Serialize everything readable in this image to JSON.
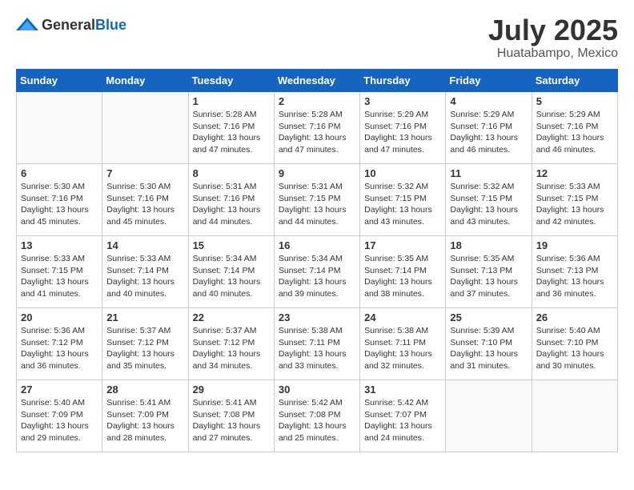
{
  "header": {
    "logo_general": "General",
    "logo_blue": "Blue",
    "month_title": "July 2025",
    "location": "Huatabampo, Mexico"
  },
  "weekdays": [
    "Sunday",
    "Monday",
    "Tuesday",
    "Wednesday",
    "Thursday",
    "Friday",
    "Saturday"
  ],
  "weeks": [
    [
      {
        "day": "",
        "info": ""
      },
      {
        "day": "",
        "info": ""
      },
      {
        "day": "1",
        "info": "Sunrise: 5:28 AM\nSunset: 7:16 PM\nDaylight: 13 hours and 47 minutes."
      },
      {
        "day": "2",
        "info": "Sunrise: 5:28 AM\nSunset: 7:16 PM\nDaylight: 13 hours and 47 minutes."
      },
      {
        "day": "3",
        "info": "Sunrise: 5:29 AM\nSunset: 7:16 PM\nDaylight: 13 hours and 47 minutes."
      },
      {
        "day": "4",
        "info": "Sunrise: 5:29 AM\nSunset: 7:16 PM\nDaylight: 13 hours and 46 minutes."
      },
      {
        "day": "5",
        "info": "Sunrise: 5:29 AM\nSunset: 7:16 PM\nDaylight: 13 hours and 46 minutes."
      }
    ],
    [
      {
        "day": "6",
        "info": "Sunrise: 5:30 AM\nSunset: 7:16 PM\nDaylight: 13 hours and 45 minutes."
      },
      {
        "day": "7",
        "info": "Sunrise: 5:30 AM\nSunset: 7:16 PM\nDaylight: 13 hours and 45 minutes."
      },
      {
        "day": "8",
        "info": "Sunrise: 5:31 AM\nSunset: 7:16 PM\nDaylight: 13 hours and 44 minutes."
      },
      {
        "day": "9",
        "info": "Sunrise: 5:31 AM\nSunset: 7:15 PM\nDaylight: 13 hours and 44 minutes."
      },
      {
        "day": "10",
        "info": "Sunrise: 5:32 AM\nSunset: 7:15 PM\nDaylight: 13 hours and 43 minutes."
      },
      {
        "day": "11",
        "info": "Sunrise: 5:32 AM\nSunset: 7:15 PM\nDaylight: 13 hours and 43 minutes."
      },
      {
        "day": "12",
        "info": "Sunrise: 5:33 AM\nSunset: 7:15 PM\nDaylight: 13 hours and 42 minutes."
      }
    ],
    [
      {
        "day": "13",
        "info": "Sunrise: 5:33 AM\nSunset: 7:15 PM\nDaylight: 13 hours and 41 minutes."
      },
      {
        "day": "14",
        "info": "Sunrise: 5:33 AM\nSunset: 7:14 PM\nDaylight: 13 hours and 40 minutes."
      },
      {
        "day": "15",
        "info": "Sunrise: 5:34 AM\nSunset: 7:14 PM\nDaylight: 13 hours and 40 minutes."
      },
      {
        "day": "16",
        "info": "Sunrise: 5:34 AM\nSunset: 7:14 PM\nDaylight: 13 hours and 39 minutes."
      },
      {
        "day": "17",
        "info": "Sunrise: 5:35 AM\nSunset: 7:14 PM\nDaylight: 13 hours and 38 minutes."
      },
      {
        "day": "18",
        "info": "Sunrise: 5:35 AM\nSunset: 7:13 PM\nDaylight: 13 hours and 37 minutes."
      },
      {
        "day": "19",
        "info": "Sunrise: 5:36 AM\nSunset: 7:13 PM\nDaylight: 13 hours and 36 minutes."
      }
    ],
    [
      {
        "day": "20",
        "info": "Sunrise: 5:36 AM\nSunset: 7:12 PM\nDaylight: 13 hours and 36 minutes."
      },
      {
        "day": "21",
        "info": "Sunrise: 5:37 AM\nSunset: 7:12 PM\nDaylight: 13 hours and 35 minutes."
      },
      {
        "day": "22",
        "info": "Sunrise: 5:37 AM\nSunset: 7:12 PM\nDaylight: 13 hours and 34 minutes."
      },
      {
        "day": "23",
        "info": "Sunrise: 5:38 AM\nSunset: 7:11 PM\nDaylight: 13 hours and 33 minutes."
      },
      {
        "day": "24",
        "info": "Sunrise: 5:38 AM\nSunset: 7:11 PM\nDaylight: 13 hours and 32 minutes."
      },
      {
        "day": "25",
        "info": "Sunrise: 5:39 AM\nSunset: 7:10 PM\nDaylight: 13 hours and 31 minutes."
      },
      {
        "day": "26",
        "info": "Sunrise: 5:40 AM\nSunset: 7:10 PM\nDaylight: 13 hours and 30 minutes."
      }
    ],
    [
      {
        "day": "27",
        "info": "Sunrise: 5:40 AM\nSunset: 7:09 PM\nDaylight: 13 hours and 29 minutes."
      },
      {
        "day": "28",
        "info": "Sunrise: 5:41 AM\nSunset: 7:09 PM\nDaylight: 13 hours and 28 minutes."
      },
      {
        "day": "29",
        "info": "Sunrise: 5:41 AM\nSunset: 7:08 PM\nDaylight: 13 hours and 27 minutes."
      },
      {
        "day": "30",
        "info": "Sunrise: 5:42 AM\nSunset: 7:08 PM\nDaylight: 13 hours and 25 minutes."
      },
      {
        "day": "31",
        "info": "Sunrise: 5:42 AM\nSunset: 7:07 PM\nDaylight: 13 hours and 24 minutes."
      },
      {
        "day": "",
        "info": ""
      },
      {
        "day": "",
        "info": ""
      }
    ]
  ]
}
